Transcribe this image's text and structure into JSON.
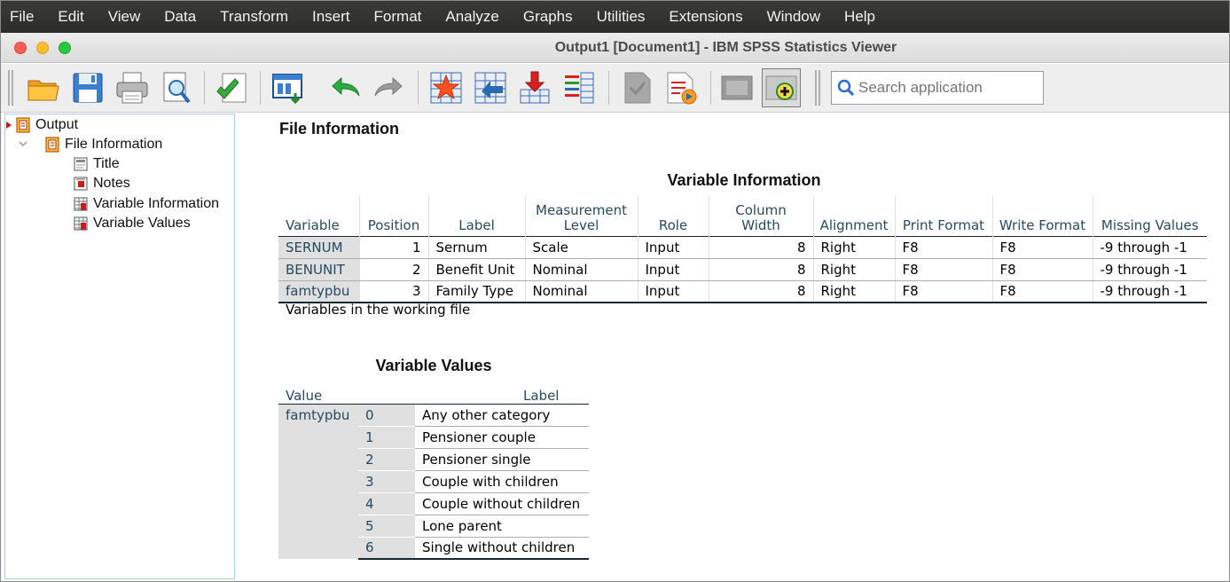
{
  "menubar": {
    "items": [
      "File",
      "Edit",
      "View",
      "Data",
      "Transform",
      "Insert",
      "Format",
      "Analyze",
      "Graphs",
      "Utilities",
      "Extensions",
      "Window",
      "Help"
    ]
  },
  "window": {
    "title": "Output1 [Document1] - IBM SPSS Statistics Viewer"
  },
  "toolbar": {
    "buttons": [
      "open-icon",
      "save-icon",
      "print-icon",
      "print-preview-icon",
      "export-icon",
      "recall-dialog-icon",
      "undo-icon",
      "redo-icon",
      "goto-data-icon",
      "goto-case-icon",
      "insert-variable-icon",
      "variables-icon",
      "designate-window-icon",
      "script-icon",
      "collapse-icon",
      "expand-icon"
    ],
    "search_placeholder": "Search application"
  },
  "outline": {
    "root": "Output",
    "group": "File Information",
    "items": [
      "Title",
      "Notes",
      "Variable Information",
      "Variable Values"
    ]
  },
  "content": {
    "heading": "File Information",
    "variable_information": {
      "title": "Variable Information",
      "columns": [
        "Variable",
        "Position",
        "Label",
        "Measurement Level",
        "Role",
        "Column Width",
        "Alignment",
        "Print Format",
        "Write Format",
        "Missing Values"
      ],
      "rows": [
        [
          "SERNUM",
          "1",
          "Sernum",
          "Scale",
          "Input",
          "8",
          "Right",
          "F8",
          "F8",
          "-9 through -1"
        ],
        [
          "BENUNIT",
          "2",
          "Benefit Unit",
          "Nominal",
          "Input",
          "8",
          "Right",
          "F8",
          "F8",
          "-9 through -1"
        ],
        [
          "famtypbu",
          "3",
          "Family Type",
          "Nominal",
          "Input",
          "8",
          "Right",
          "F8",
          "F8",
          "-9 through -1"
        ]
      ],
      "footnote": "Variables in the working file"
    },
    "variable_values": {
      "title": "Variable Values",
      "columns": [
        "Value",
        "Label"
      ],
      "variable": "famtypbu",
      "rows": [
        [
          "0",
          "Any other category"
        ],
        [
          "1",
          "Pensioner couple"
        ],
        [
          "2",
          "Pensioner single"
        ],
        [
          "3",
          "Couple with children"
        ],
        [
          "4",
          "Couple without children"
        ],
        [
          "5",
          "Lone parent"
        ],
        [
          "6",
          "Single without children"
        ]
      ]
    }
  }
}
